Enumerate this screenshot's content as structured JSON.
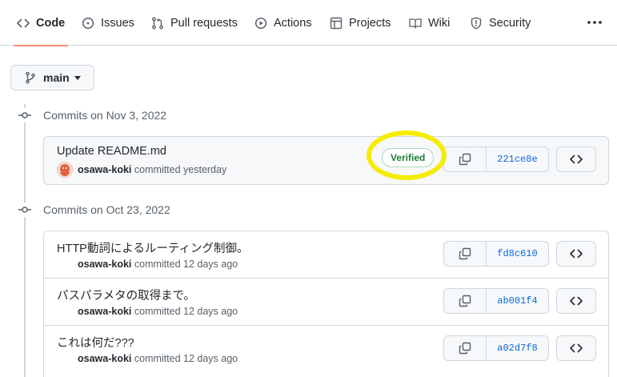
{
  "nav": {
    "tabs": [
      {
        "label": "Code",
        "icon": "code-icon",
        "active": true
      },
      {
        "label": "Issues",
        "icon": "issue-opened-icon"
      },
      {
        "label": "Pull requests",
        "icon": "git-pull-request-icon"
      },
      {
        "label": "Actions",
        "icon": "play-icon"
      },
      {
        "label": "Projects",
        "icon": "table-icon"
      },
      {
        "label": "Wiki",
        "icon": "book-icon"
      },
      {
        "label": "Security",
        "icon": "shield-icon"
      }
    ],
    "more_icon": "kebab-horizontal-icon"
  },
  "branch": {
    "label": "main",
    "icon": "git-branch-icon"
  },
  "groups": [
    {
      "date": "Commits on Nov 3, 2022",
      "commits": [
        {
          "title": "Update README.md",
          "author": "osawa-koki",
          "action": "committed",
          "when": "yesterday",
          "verified": "Verified",
          "sha": "221ce8e",
          "avatar": true
        }
      ]
    },
    {
      "date": "Commits on Oct 23, 2022",
      "commits": [
        {
          "title": "HTTP動詞によるルーティング制御。",
          "author": "osawa-koki",
          "action": "committed",
          "when": "12 days ago",
          "sha": "fd8c610"
        },
        {
          "title": "パスパラメタの取得まで。",
          "author": "osawa-koki",
          "action": "committed",
          "when": "12 days ago",
          "sha": "ab001f4"
        },
        {
          "title": "これは何だ???",
          "author": "osawa-koki",
          "action": "committed",
          "when": "12 days ago",
          "sha": "a02d7f8"
        }
      ]
    }
  ],
  "colors": {
    "accent_underline": "#fd8c73",
    "link": "#0969da",
    "verified": "#1a7f37",
    "highlight": "#f5ec00"
  }
}
